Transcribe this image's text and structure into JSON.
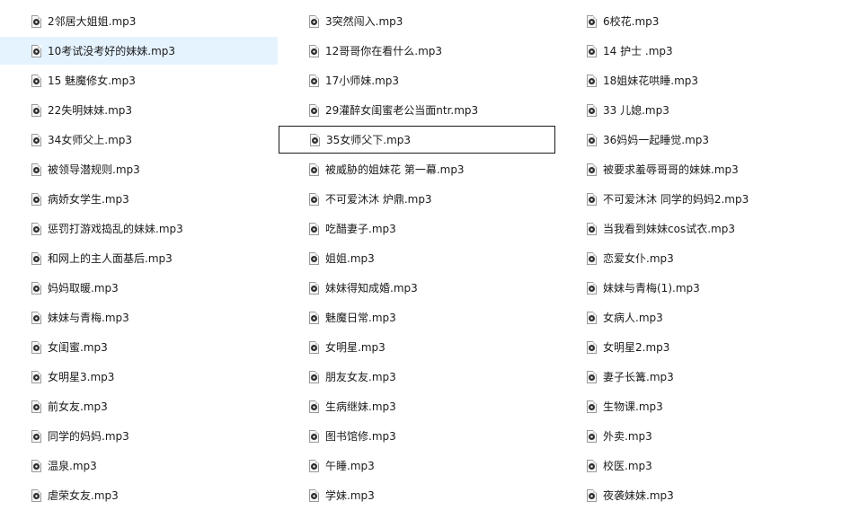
{
  "files": [
    "2邻居大姐姐.mp3",
    "3突然闯入.mp3",
    "6校花.mp3",
    "10考试没考好的妹妹.mp3",
    "12哥哥你在看什么.mp3",
    "14 护士 .mp3",
    "15 魅魔修女.mp3",
    "17小师妹.mp3",
    "18姐妹花哄睡.mp3",
    "22失明妹妹.mp3",
    "29灌醉女闺蜜老公当面ntr.mp3",
    "33 儿媳.mp3",
    "34女师父上.mp3",
    "35女师父下.mp3",
    "36妈妈一起睡觉.mp3",
    "被领导潜规则.mp3",
    "被威胁的姐妹花 第一幕.mp3",
    "被要求羞辱哥哥的妹妹.mp3",
    "病娇女学生.mp3",
    "不可爱沐沐 炉鼎.mp3",
    "不可爱沐沐 同学的妈妈2.mp3",
    "惩罚打游戏捣乱的妹妹.mp3",
    "吃醋妻子.mp3",
    "当我看到妹妹cos试衣.mp3",
    "和网上的主人面基后.mp3",
    "姐姐.mp3",
    "恋爱女仆.mp3",
    "妈妈取暖.mp3",
    "妹妹得知成婚.mp3",
    "妹妹与青梅(1).mp3",
    "妹妹与青梅.mp3",
    "魅魔日常.mp3",
    "女病人.mp3",
    "女闺蜜.mp3",
    "女明星.mp3",
    "女明星2.mp3",
    "女明星3.mp3",
    "朋友女友.mp3",
    "妻子长篝.mp3",
    "前女友.mp3",
    "生病继妹.mp3",
    "生物课.mp3",
    "同学的妈妈.mp3",
    "图书馆修.mp3",
    "外卖.mp3",
    "温泉.mp3",
    "午睡.mp3",
    "校医.mp3",
    "虐荣女友.mp3",
    "学妹.mp3",
    "夜袭妹妹.mp3"
  ],
  "selected_index": 3,
  "focused_index": 13,
  "icon": "audio-file-icon",
  "colors": {
    "selection_background": "#e5f3ff",
    "focus_border": "#1a1a1a"
  }
}
